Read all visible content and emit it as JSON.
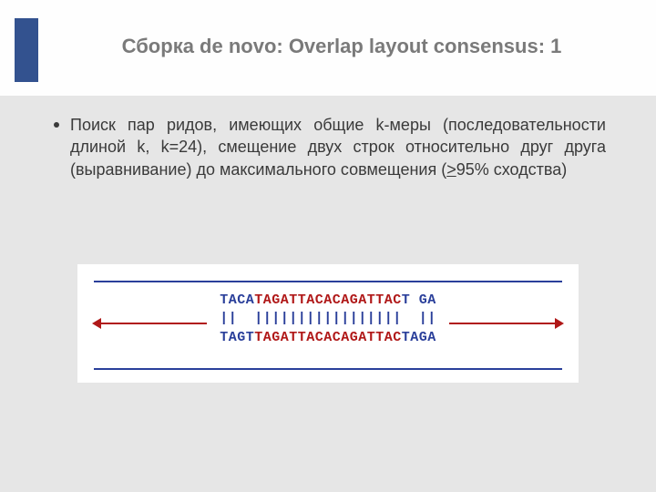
{
  "title": "Сборка de novo: Overlap layout consensus: 1",
  "bullet": {
    "pre": "Поиск пар ридов, имеющих общие k-меры (последовательности длиной k, k=24), смещение двух строк относительно друг друга (выравнивание) до максимального совмещения (",
    "ge": ">",
    "post": "95% сходства)"
  },
  "alignment": {
    "read1_prefix": "TACA",
    "read1_core": "TAGATTACACAGATTAC",
    "read1_gap": "T GA",
    "matches": "||  |||||||||||||||||  ||",
    "read2_prefix": "TAGT",
    "read2_core": "TAGATTACACAGATTAC",
    "read2_suffix": "TAGA"
  }
}
